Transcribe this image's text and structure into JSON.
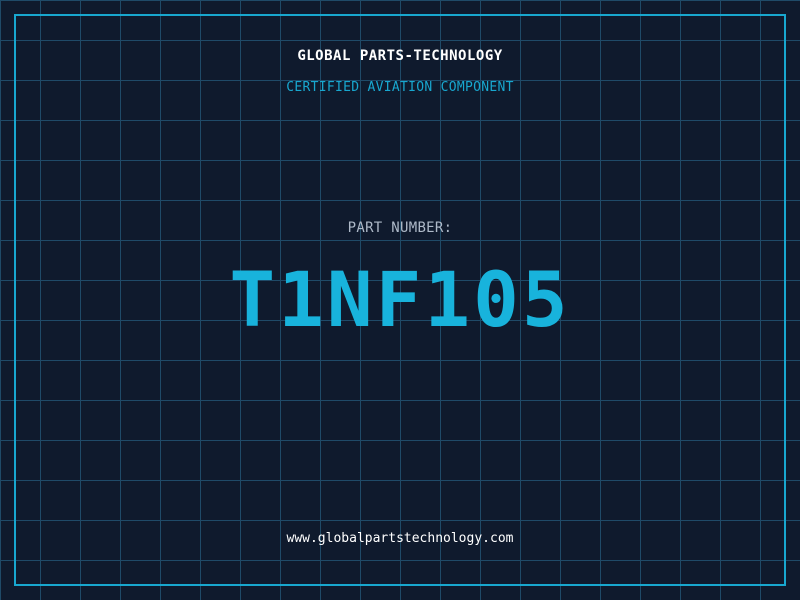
{
  "header": {
    "company": "GLOBAL PARTS-TECHNOLOGY",
    "subtitle": "CERTIFIED AVIATION COMPONENT"
  },
  "part": {
    "label": "PART NUMBER:",
    "number": "T1NF105"
  },
  "footer": {
    "website": "www.globalpartstechnology.com"
  },
  "colors": {
    "background": "#0f1a2d",
    "grid": "#1f4a68",
    "accent": "#18a7cf",
    "text": "#ffffff",
    "muted": "#aeb9c8"
  }
}
